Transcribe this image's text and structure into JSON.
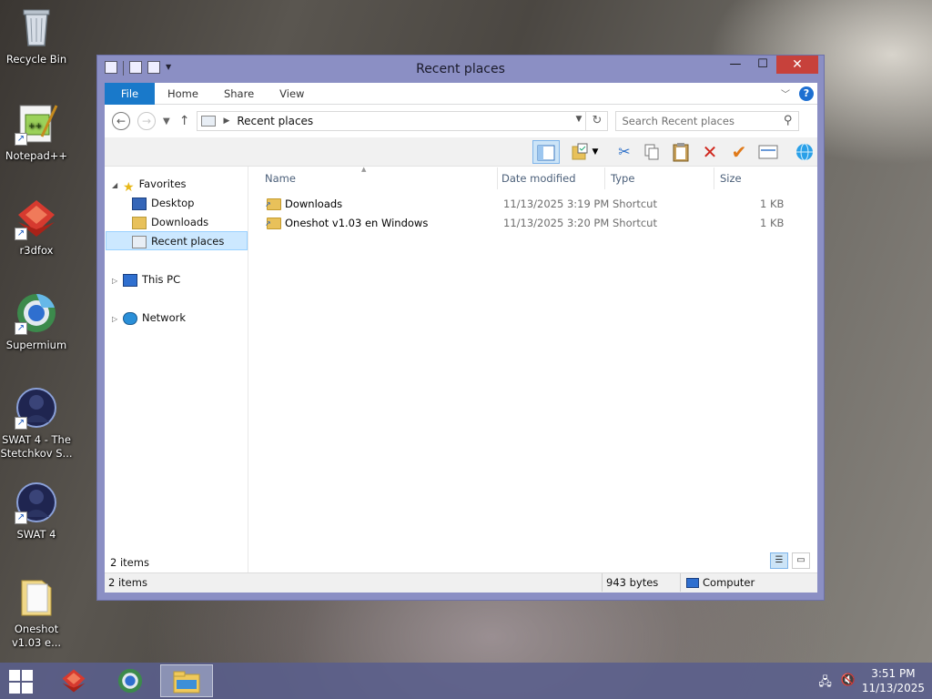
{
  "desktop": {
    "icons": [
      {
        "label": "Recycle Bin",
        "icon": "recycle-bin-icon"
      },
      {
        "label": "Notepad++",
        "icon": "notepad-plus-plus-icon"
      },
      {
        "label": "r3dfox",
        "icon": "r3dfox-icon"
      },
      {
        "label": "Supermium",
        "icon": "supermium-icon"
      },
      {
        "label": "SWAT 4 - The Stetchkov S...",
        "icon": "swat4-stetchkov-icon"
      },
      {
        "label": "SWAT 4",
        "icon": "swat4-icon"
      },
      {
        "label": "Oneshot v1.03 e...",
        "icon": "oneshot-folder-icon"
      }
    ]
  },
  "window": {
    "title": "Recent places",
    "tabs": {
      "file": "File",
      "home": "Home",
      "share": "Share",
      "view": "View"
    },
    "address": {
      "path_label": "Recent places"
    },
    "search": {
      "placeholder": "Search Recent places"
    },
    "nav": {
      "favorites": "Favorites",
      "desktop": "Desktop",
      "downloads": "Downloads",
      "recent_places": "Recent places",
      "this_pc": "This PC",
      "network": "Network"
    },
    "columns": {
      "name": "Name",
      "date_modified": "Date modified",
      "type": "Type",
      "size": "Size"
    },
    "files": [
      {
        "name": "Downloads",
        "date_modified": "11/13/2025 3:19 PM",
        "type": "Shortcut",
        "size": "1 KB"
      },
      {
        "name": "Oneshot v1.03 en Windows",
        "date_modified": "11/13/2025 3:20 PM",
        "type": "Shortcut",
        "size": "1 KB"
      }
    ],
    "item_count": "2 items",
    "status": {
      "items": "2 items",
      "bytes": "943 bytes",
      "location": "Computer"
    }
  },
  "taskbar": {
    "time": "3:51 PM",
    "date": "11/13/2025"
  },
  "colors": {
    "file_tab": "#1979ca",
    "window_frame": "#8b8fc4",
    "close_button": "#c7413b",
    "selection": "#cce8ff"
  }
}
